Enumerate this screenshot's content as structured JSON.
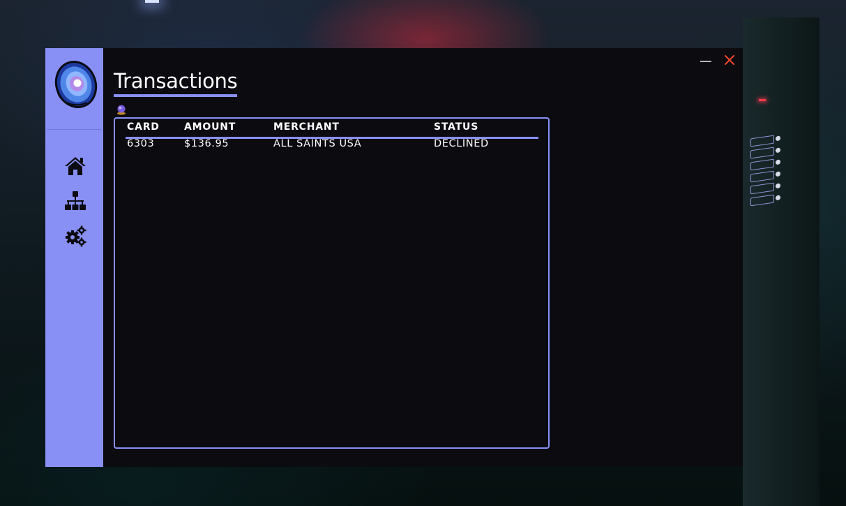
{
  "window": {
    "title": "Transactions"
  },
  "colors": {
    "accent": "#8890f6",
    "background": "#0b0b10",
    "close": "#e8462a",
    "text": "#ffffff"
  },
  "icons": {
    "logo": "galaxy-logo-icon",
    "orb": "crystal-ball-icon",
    "nav": [
      "home-icon",
      "sitemap-icon",
      "gears-icon"
    ],
    "titlebar": [
      "minimize-icon",
      "close-icon"
    ]
  },
  "table": {
    "headers": [
      "CARD",
      "AMOUNT",
      "MERCHANT",
      "STATUS"
    ],
    "rows": [
      [
        "6303",
        "$136.95",
        "ALL SAINTS USA",
        "DECLINED"
      ]
    ]
  }
}
